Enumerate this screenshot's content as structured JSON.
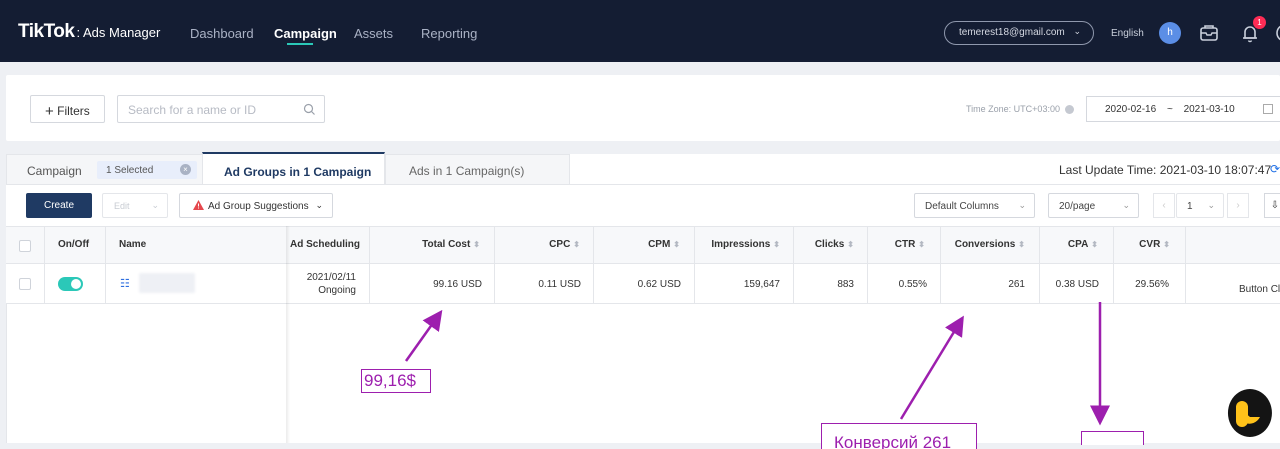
{
  "topbar": {
    "brand": "TikTok",
    "brand_sub": "Ads Manager",
    "nav": [
      "Dashboard",
      "Campaign",
      "Assets",
      "Reporting"
    ],
    "active_nav": "Campaign",
    "account_email": "temerest18@gmail.com",
    "language": "English",
    "avatar_initial": "h",
    "notification_count": "1"
  },
  "filters": {
    "filters_label": "Filters",
    "search_placeholder": "Search for a name or ID",
    "timezone": "Time Zone: UTC+03:00",
    "date_start": "2020-02-16",
    "date_sep": "~",
    "date_end": "2021-03-10"
  },
  "tabs": {
    "campaign": "Campaign",
    "selected_chip": "1 Selected",
    "ad_groups": "Ad Groups in 1 Campaign",
    "ads": "Ads in 1 Campaign(s)",
    "last_update": "Last Update Time: 2021-03-10 18:07:47"
  },
  "toolbar": {
    "create": "Create",
    "edit": "Edit",
    "suggestions": "Ad Group Suggestions",
    "columns": "Default Columns",
    "page_size": "20/page",
    "page": "1"
  },
  "table": {
    "headers": {
      "onoff": "On/Off",
      "name": "Name",
      "schedule": "Ad Scheduling",
      "total_cost": "Total Cost",
      "cpc": "CPC",
      "cpm": "CPM",
      "impressions": "Impressions",
      "clicks": "Clicks",
      "ctr": "CTR",
      "conversions": "Conversions",
      "cpa": "CPA",
      "cvr": "CVR"
    },
    "row": {
      "schedule_date": "2021/02/11",
      "schedule_status": "Ongoing",
      "total_cost": "99.16 USD",
      "cpc": "0.11 USD",
      "cpm": "0.62 USD",
      "impressions": "159,647",
      "clicks": "883",
      "ctr": "0.55%",
      "conversions": "261",
      "cpa": "0.38 USD",
      "cvr": "29.56%",
      "extra": "Button Cl"
    }
  },
  "annotations": {
    "cost": "99,16$",
    "conversions": "Конверсий 261",
    "color": "#9d1fae"
  },
  "colors": {
    "topbar": "#141d33",
    "accent": "#2bc8b8",
    "primary": "#1f3a63",
    "badge": "#fe2c55"
  }
}
